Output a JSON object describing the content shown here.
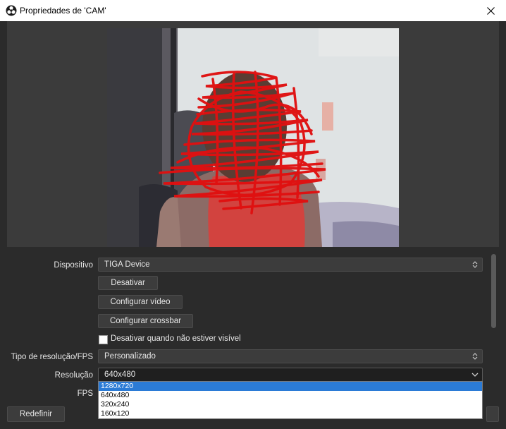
{
  "window": {
    "title": "Propriedades de 'CAM'"
  },
  "properties": {
    "device_label": "Dispositivo",
    "device_value": "TIGA  Device",
    "deactivate_button": "Desativar",
    "configure_video_button": "Configurar vídeo",
    "configure_crossbar_button": "Configurar crossbar",
    "deactivate_when_hidden_label": "Desativar quando não estiver visível",
    "deactivate_when_hidden_checked": false,
    "resolution_fps_type_label": "Tipo de resolução/FPS",
    "resolution_fps_type_value": "Personalizado",
    "resolution_label": "Resolução",
    "resolution_value": "640x480",
    "fps_label": "FPS",
    "resolution_options": [
      "1280x720",
      "640x480",
      "320x240",
      "160x120"
    ],
    "resolution_selected_index": 0
  },
  "footer": {
    "reset_button": "Redefinir"
  },
  "colors": {
    "accent": "#2b7bd6",
    "background": "#2b2b2b",
    "field": "#3c3c3c"
  }
}
